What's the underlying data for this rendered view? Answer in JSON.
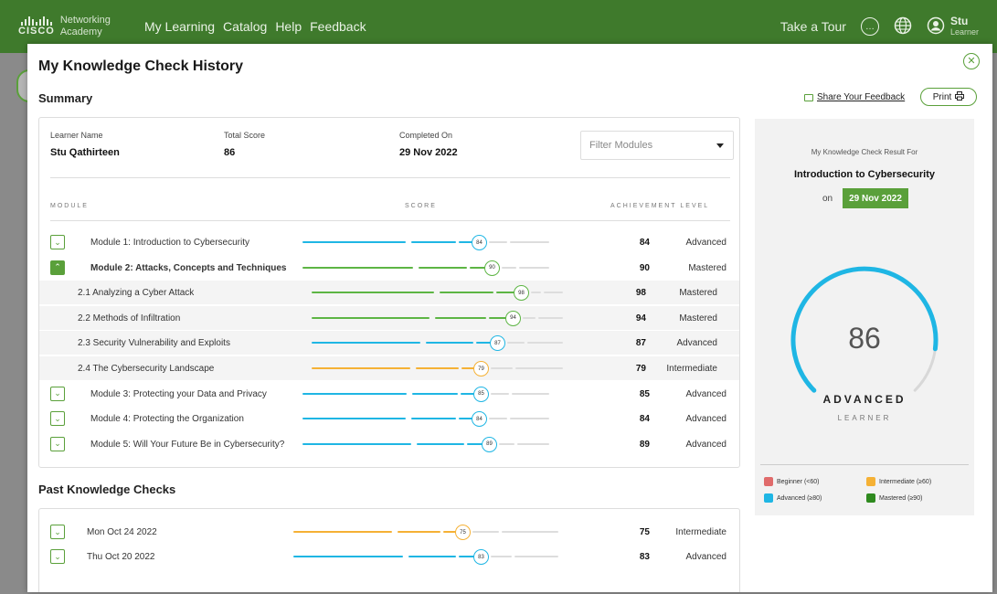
{
  "nav": {
    "brand": "Networking",
    "brand_sub": "Academy",
    "brand_cisco": "CISCO",
    "links": [
      "My Learning",
      "Catalog",
      "Help",
      "Feedback"
    ],
    "tour": "Take a Tour",
    "user_name": "Stu",
    "user_role": "Learner"
  },
  "modal": {
    "title": "My Knowledge Check History",
    "summary_heading": "Summary",
    "share_label": "Share Your Feedback",
    "print_label": "Print",
    "learner_label": "Learner Name",
    "learner_value": "Stu Qathirteen",
    "total_label": "Total Score",
    "total_value": "86",
    "completed_label": "Completed On",
    "completed_value": "29 Nov 2022",
    "filter_placeholder": "Filter Modules",
    "col_module": "MODULE",
    "col_score": "SCORE",
    "col_achievement": "ACHIEVEMENT LEVEL",
    "past_heading": "Past Knowledge Checks"
  },
  "colors": {
    "advanced": "#1fb6e4",
    "mastered": "#5db544",
    "intermediate": "#f5b135",
    "beginner": "#e06b6b",
    "track": "#dddddd",
    "brand": "#3f7a2c"
  },
  "modules": [
    {
      "name": "Module 1: Introduction to Cybersecurity",
      "score": 84,
      "level": "Advanced",
      "kind": "module",
      "toggle": "closed"
    },
    {
      "name": "Module 2: Attacks, Concepts and Techniques",
      "score": 90,
      "level": "Mastered",
      "kind": "module",
      "toggle": "open",
      "bold": true
    },
    {
      "name": "2.1 Analyzing a Cyber Attack",
      "score": 98,
      "level": "Mastered",
      "kind": "sub"
    },
    {
      "name": "2.2 Methods of Infiltration",
      "score": 94,
      "level": "Mastered",
      "kind": "sub"
    },
    {
      "name": "2.3 Security Vulnerability and Exploits",
      "score": 87,
      "level": "Advanced",
      "kind": "sub"
    },
    {
      "name": "2.4 The Cybersecurity Landscape",
      "score": 79,
      "level": "Intermediate",
      "kind": "sub"
    },
    {
      "name": "Module 3: Protecting your Data and Privacy",
      "score": 85,
      "level": "Advanced",
      "kind": "module",
      "toggle": "closed"
    },
    {
      "name": "Module 4: Protecting the Organization",
      "score": 84,
      "level": "Advanced",
      "kind": "module",
      "toggle": "closed"
    },
    {
      "name": "Module 5: Will Your Future Be in Cybersecurity?",
      "score": 89,
      "level": "Advanced",
      "kind": "module",
      "toggle": "closed"
    }
  ],
  "past_checks": [
    {
      "date": "Mon Oct 24 2022",
      "score": 75,
      "level": "Intermediate"
    },
    {
      "date": "Thu Oct 20 2022",
      "score": 83,
      "level": "Advanced"
    }
  ],
  "result": {
    "title": "My Knowledge Check Result For",
    "course": "Introduction to Cybersecurity",
    "on_label": "on",
    "date": "29 Nov 2022",
    "score": 86,
    "score_text": "86",
    "level": "ADVANCED",
    "role": "LEARNER"
  },
  "legend": [
    {
      "label": "Beginner (<60)",
      "color": "#e06b6b"
    },
    {
      "label": "Intermediate (≥60)",
      "color": "#f5b135"
    },
    {
      "label": "Advanced (≥80)",
      "color": "#1fb6e4"
    },
    {
      "label": "Mastered (≥90)",
      "color": "#2f8a1f"
    }
  ]
}
